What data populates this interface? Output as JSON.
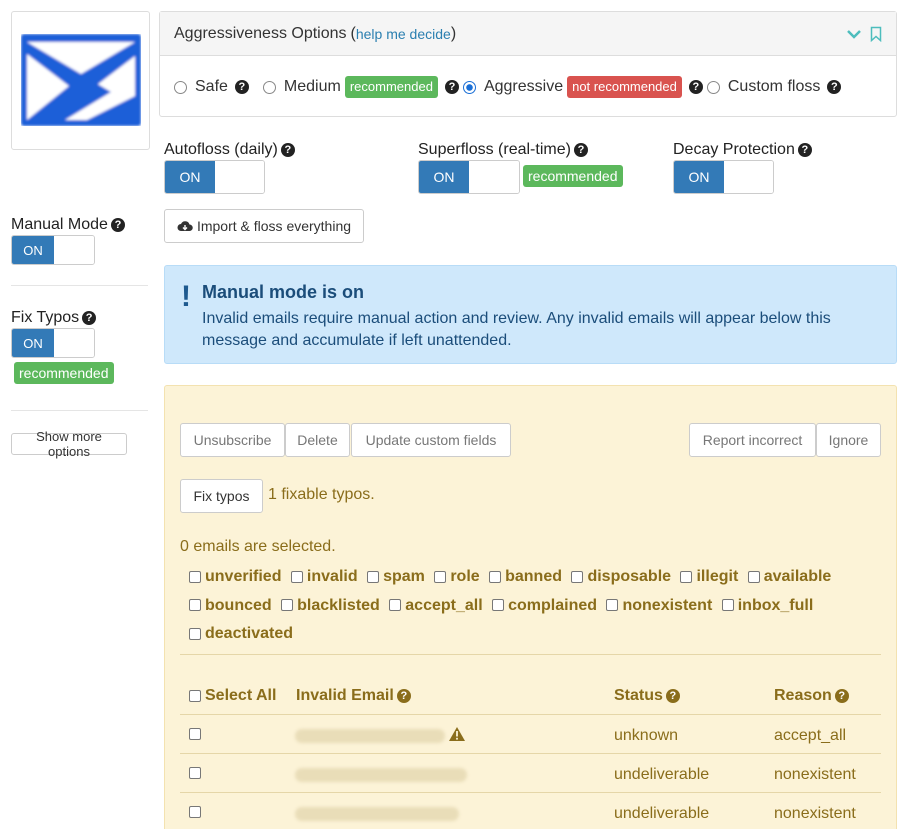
{
  "colors": {
    "primary": "#337ab7",
    "success": "#5cb85c",
    "danger": "#d9534f",
    "link": "#2a7fb0",
    "warn_text": "#8a6d1b"
  },
  "aggressiveness": {
    "title": "Aggressiveness Options",
    "help_open": "(",
    "help_link": "help me decide",
    "help_close": ")",
    "options": [
      {
        "label": "Safe",
        "checked": false
      },
      {
        "label": "Medium",
        "checked": false,
        "badge": "recommended"
      },
      {
        "label": "Aggressive",
        "checked": true,
        "badge": "not recommended"
      },
      {
        "label": "Custom floss",
        "checked": false
      }
    ]
  },
  "toggles": {
    "autofloss": {
      "label": "Autofloss (daily)",
      "state": "ON"
    },
    "superfloss": {
      "label": "Superfloss (real-time)",
      "state": "ON",
      "badge": "recommended"
    },
    "decay": {
      "label": "Decay Protection",
      "state": "ON"
    }
  },
  "sidebar": {
    "manual": {
      "label": "Manual Mode",
      "state": "ON"
    },
    "typos": {
      "label": "Fix Typos",
      "state": "ON",
      "badge": "recommended"
    },
    "more_button": "Show more options"
  },
  "import_button": "Import & floss everything",
  "alert": {
    "title": "Manual mode is on",
    "message": "Invalid emails require manual action and review. Any invalid emails will appear below this message and accumulate if left unattended."
  },
  "actions": {
    "unsubscribe": "Unsubscribe",
    "delete": "Delete",
    "update": "Update custom fields",
    "report": "Report incorrect",
    "ignore": "Ignore",
    "fix_typos": "Fix typos",
    "fixable_text": "1 fixable typos."
  },
  "selected_text": "0 emails are selected.",
  "categories": [
    [
      "unverified",
      "invalid",
      "spam",
      "role",
      "banned",
      "disposable",
      "illegit",
      "available"
    ],
    [
      "bounced",
      "blacklisted",
      "accept_all",
      "complained",
      "nonexistent",
      "inbox_full"
    ],
    [
      "deactivated"
    ]
  ],
  "table": {
    "headers": {
      "select_all": "Select All",
      "email": "Invalid Email",
      "status": "Status",
      "reason": "Reason"
    },
    "rows": [
      {
        "status": "unknown",
        "reason": "accept_all",
        "warning": true
      },
      {
        "status": "undeliverable",
        "reason": "nonexistent",
        "warning": false
      },
      {
        "status": "undeliverable",
        "reason": "nonexistent",
        "warning": false
      }
    ]
  }
}
